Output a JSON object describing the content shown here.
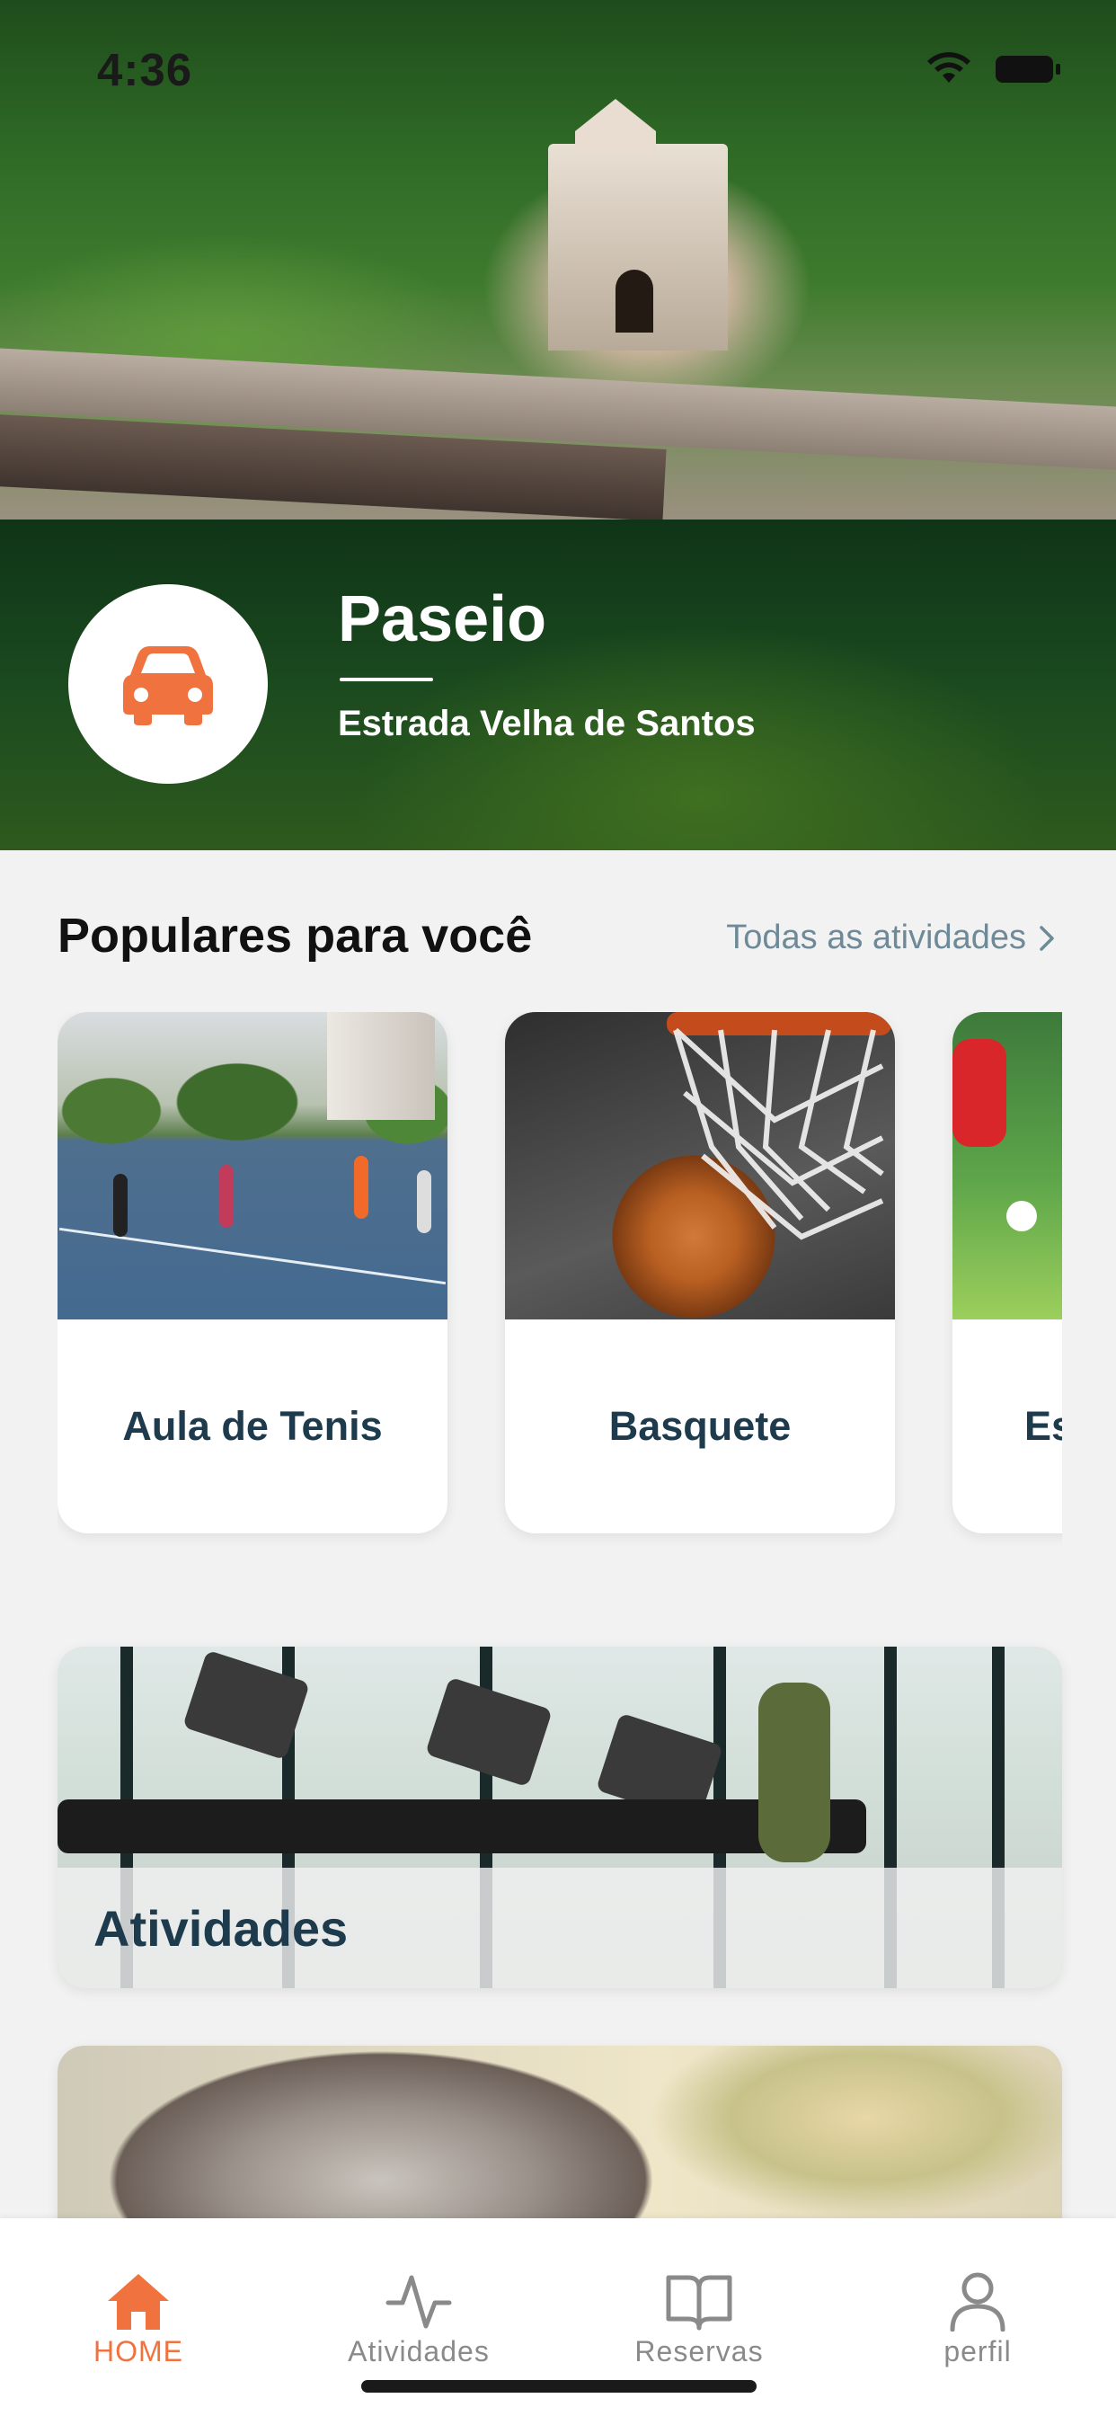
{
  "status": {
    "time": "4:36"
  },
  "location": {
    "title": "Paseio",
    "subtitle": "Estrada Velha de Santos",
    "icon": "car-icon",
    "accent_color": "#f0733f"
  },
  "popular": {
    "title": "Populares para você",
    "see_all": "Todas as atividades",
    "cards": [
      {
        "label": "Aula de Tenis",
        "image": "tennis-court-photo"
      },
      {
        "label": "Basquete",
        "image": "basketball-net-photo"
      },
      {
        "label": "Es",
        "image": "soccer-kids-photo"
      }
    ]
  },
  "banners": [
    {
      "label": "Atividades",
      "image": "gym-treadmill-photo"
    },
    {
      "label": "",
      "image": "grill-photo"
    }
  ],
  "tabbar": {
    "items": [
      {
        "label": "HOME",
        "icon": "home-icon",
        "active": true
      },
      {
        "label": "Atividades",
        "icon": "activity-icon",
        "active": false
      },
      {
        "label": "Reservas",
        "icon": "book-icon",
        "active": false
      },
      {
        "label": "perfil",
        "icon": "user-icon",
        "active": false
      }
    ]
  }
}
